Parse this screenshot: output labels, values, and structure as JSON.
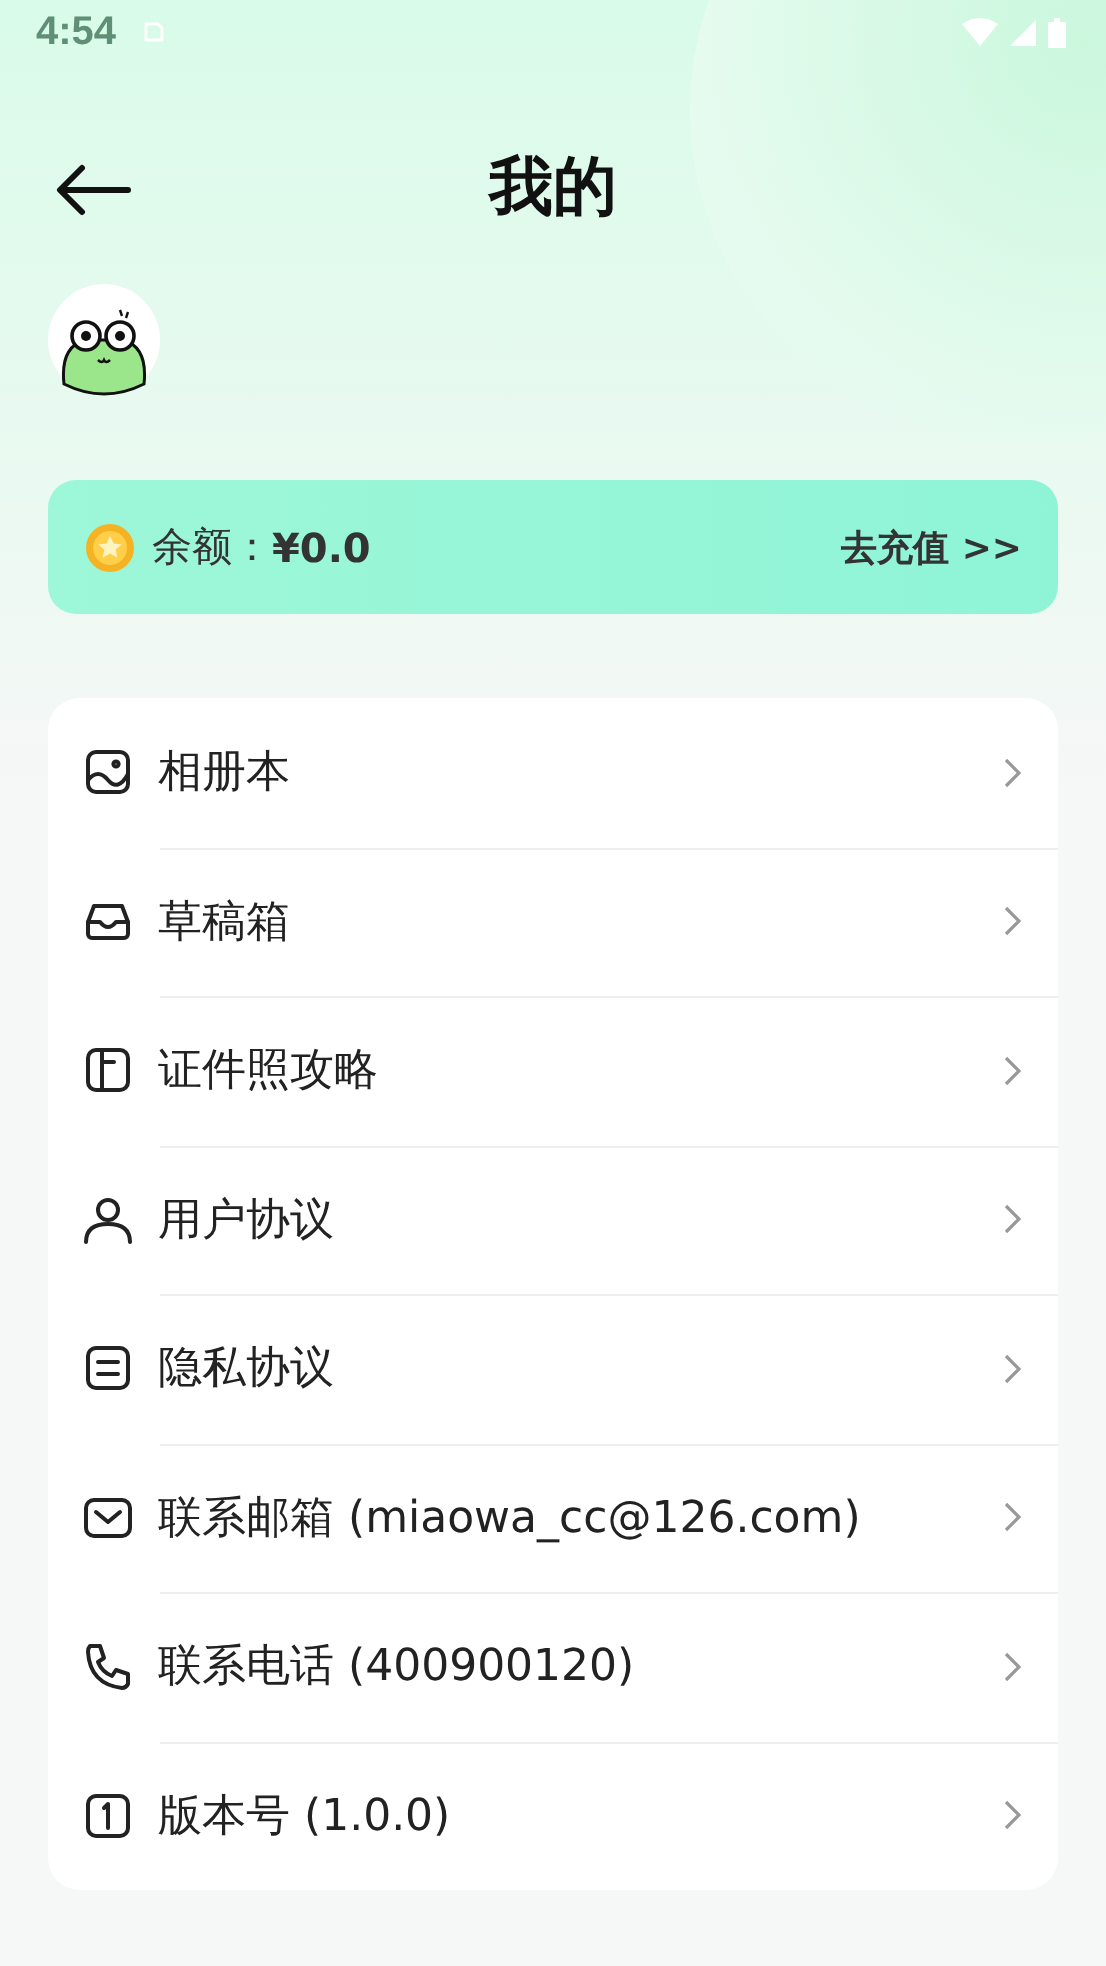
{
  "status_bar": {
    "time": "4:54"
  },
  "header": {
    "title": "我的"
  },
  "balance": {
    "label": "余额：",
    "amount": "¥0.0",
    "action": "去充值 >>"
  },
  "menu": [
    {
      "kind": "album",
      "label": "相册本"
    },
    {
      "kind": "drafts",
      "label": "草稿箱"
    },
    {
      "kind": "guide",
      "label": "证件照攻略"
    },
    {
      "kind": "user",
      "label": "用户协议"
    },
    {
      "kind": "privacy",
      "label": "隐私协议"
    },
    {
      "kind": "mail",
      "label": "联系邮箱 (miaowa_cc@126.com)"
    },
    {
      "kind": "phone",
      "label": "联系电话 (400900120)"
    },
    {
      "kind": "version",
      "label": "版本号 (1.0.0)"
    }
  ]
}
